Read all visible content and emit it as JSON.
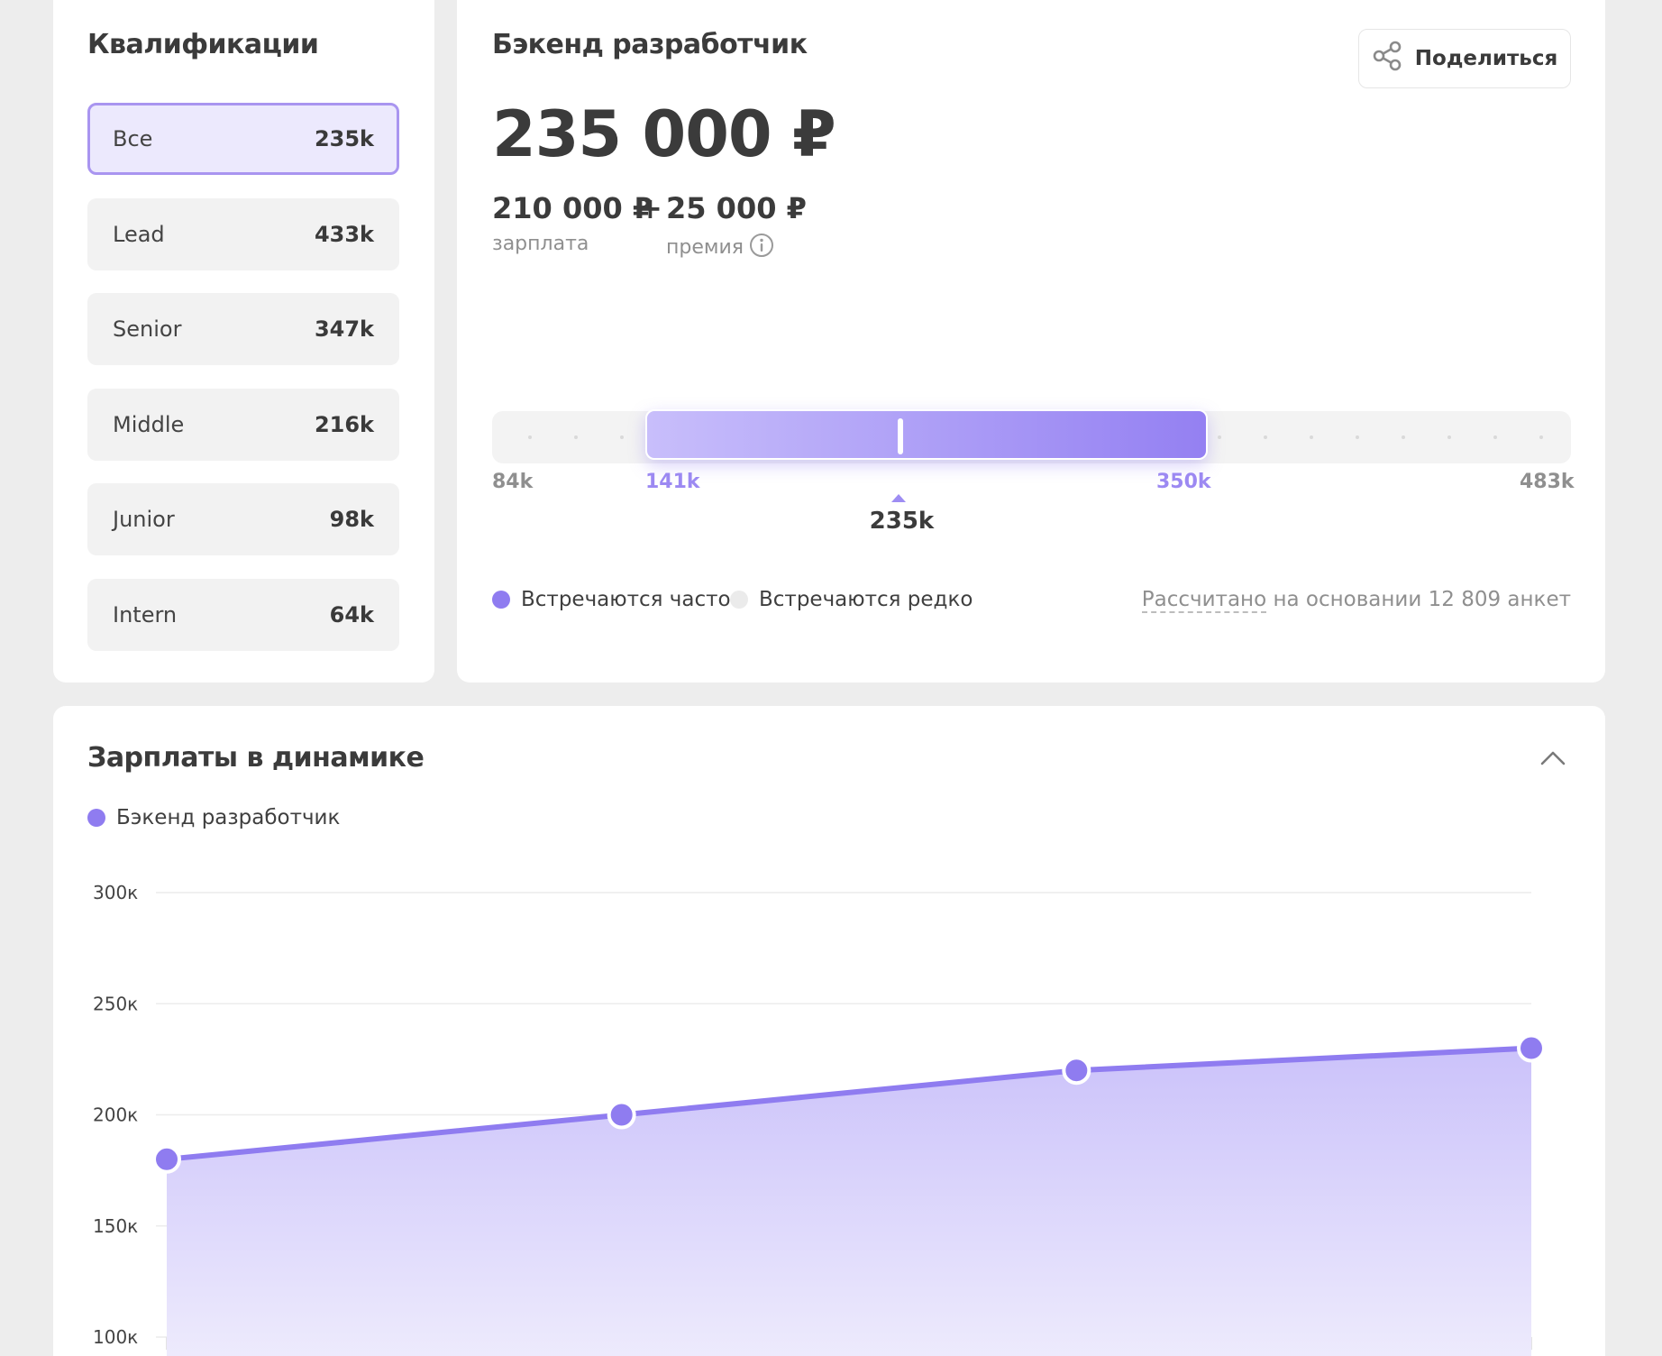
{
  "qualifications": {
    "title": "Квалификации",
    "items": [
      {
        "label": "Все",
        "value": "235k",
        "active": true
      },
      {
        "label": "Lead",
        "value": "433k",
        "active": false
      },
      {
        "label": "Senior",
        "value": "347k",
        "active": false
      },
      {
        "label": "Middle",
        "value": "216k",
        "active": false
      },
      {
        "label": "Junior",
        "value": "98k",
        "active": false
      },
      {
        "label": "Intern",
        "value": "64k",
        "active": false
      }
    ]
  },
  "salary": {
    "title": "Бэкенд разработчик",
    "share_label": "Поделиться",
    "share_icon": "share-icon",
    "total": "235 000 ₽",
    "base_value": "210 000 ₽",
    "plus": "+",
    "bonus_value": "25 000 ₽",
    "base_label": "зарплата",
    "bonus_label": "премия",
    "info_icon": "info-icon",
    "range": {
      "min_label": "84k",
      "low_label": "141k",
      "high_label": "350k",
      "max_label": "483k",
      "median_label": "235k",
      "min": 84,
      "low": 141,
      "median": 235,
      "high": 350,
      "max": 483
    },
    "legend": {
      "often": "Встречаются часто",
      "rare": "Встречаются редко"
    },
    "basis_link": "Рассчитано",
    "basis_text": " на основании 12 809 анкет"
  },
  "dynamics": {
    "title": "Зарплаты в динамике",
    "collapse_icon": "chevron-up-icon"
  },
  "colors": {
    "accent": "#8f7cf0",
    "accent_light": "#ece9fd",
    "rare_dot": "#ebebeb",
    "muted": "#8f8f8f"
  },
  "chart_data": {
    "type": "area",
    "series": [
      {
        "name": "Бэкенд разработчик",
        "values": [
          180,
          200,
          220,
          230
        ]
      }
    ],
    "y_ticks": [
      "300к",
      "250к",
      "200к",
      "150к",
      "100к"
    ],
    "y_tick_values": [
      300,
      250,
      200,
      150,
      100
    ],
    "ylim": [
      100,
      300
    ],
    "grid": true,
    "legend_position": "top-left"
  }
}
